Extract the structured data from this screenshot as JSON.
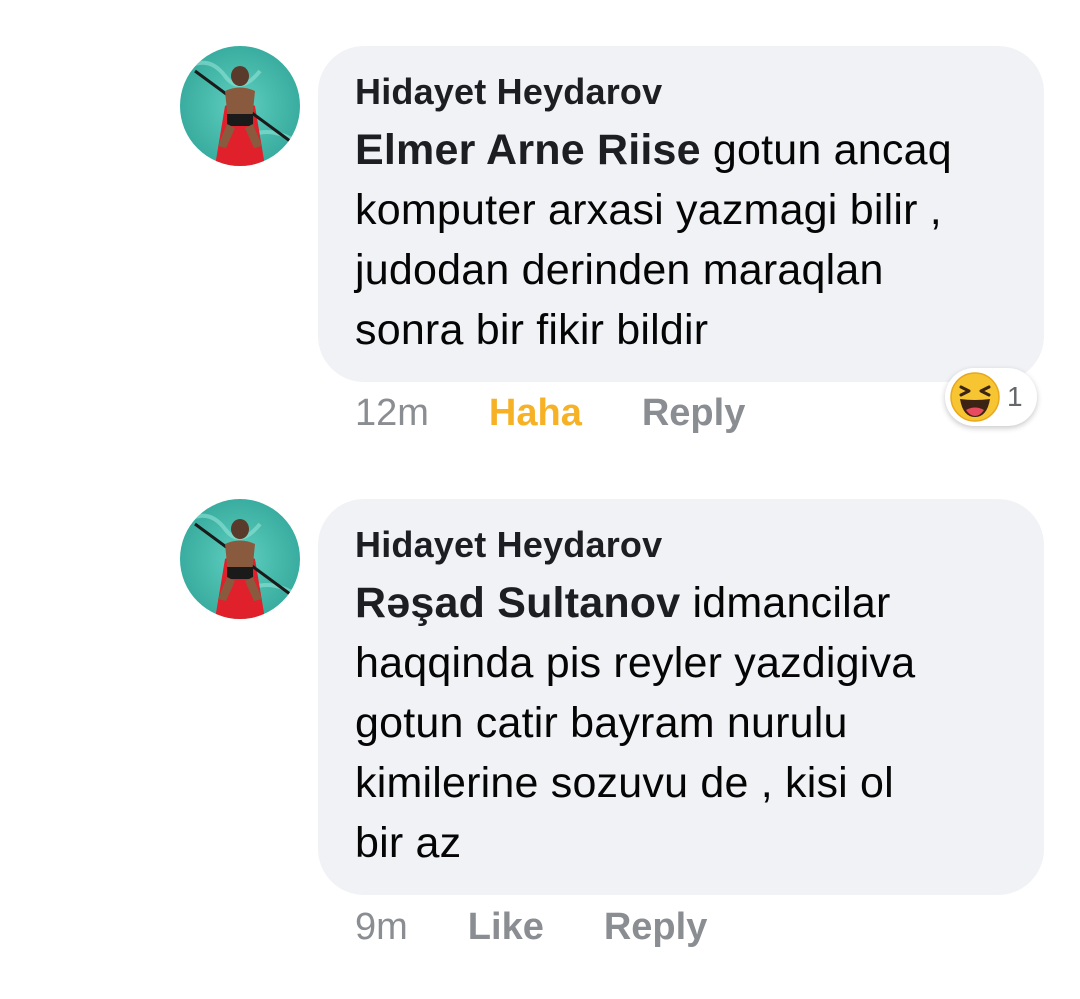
{
  "comments": [
    {
      "author": "Hidayet Heydarov",
      "mention": "Elmer Arne Riise",
      "text_lines": [
        " gotun ancaq",
        "komputer arxasi yazmagi bilir ,",
        "judodan derinden maraqlan",
        "sonra bir fikir bildir"
      ],
      "time": "12m",
      "reaction_label": "Haha",
      "reply_label": "Reply",
      "reaction_summary": {
        "icon": "haha-emoji-icon",
        "count": "1"
      }
    },
    {
      "author": "Hidayet Heydarov",
      "mention": "Rəşad Sultanov",
      "text_lines": [
        " idmancilar",
        "haqqinda pis reyler yazdigiva",
        "gotun catir bayram nurulu",
        "kimilerine sozuvu de , kisi ol",
        "bir az"
      ],
      "time": "9m",
      "reaction_label": "Like",
      "reply_label": "Reply"
    }
  ],
  "colors": {
    "bubble_bg": "#f0f2f5",
    "meta_gray": "#8a8d91",
    "haha_active": "#f7b125"
  }
}
